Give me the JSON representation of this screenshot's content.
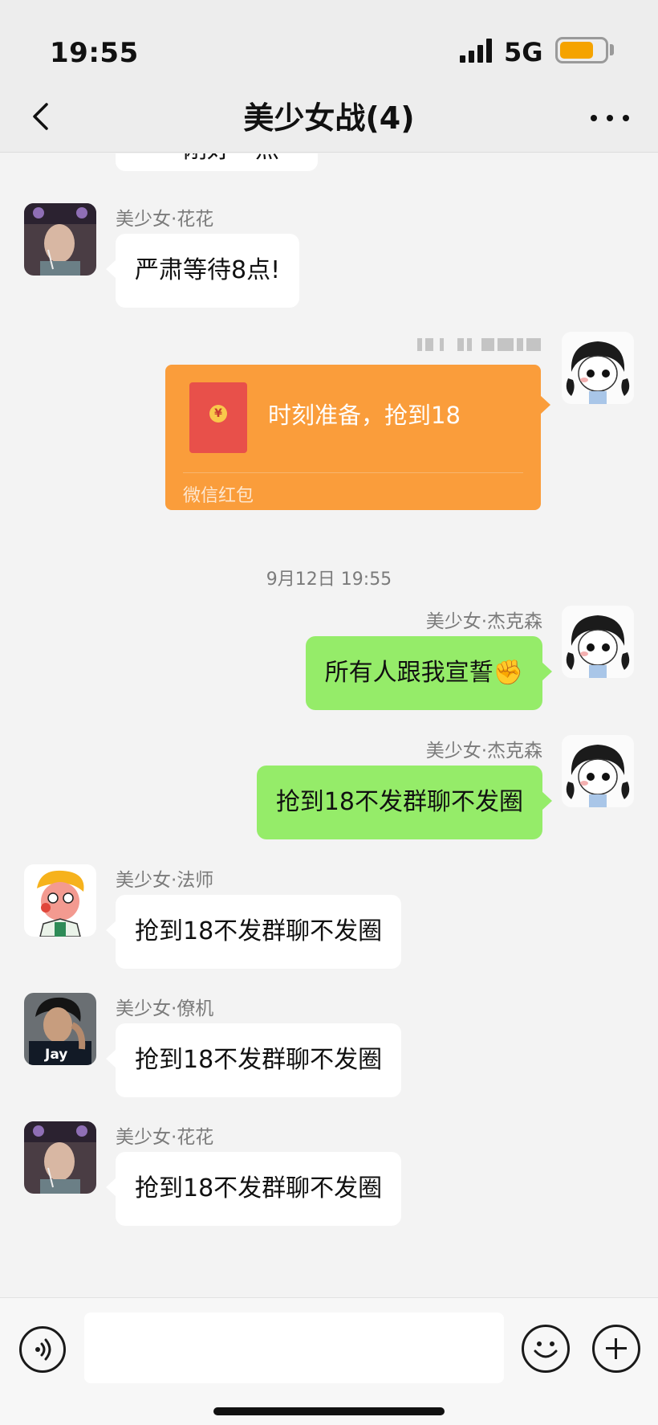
{
  "status_bar": {
    "time": "19:55",
    "network": "5G",
    "battery_level": 0.75
  },
  "nav": {
    "title": "美少女战(4)"
  },
  "chat": {
    "partial_top_text": "一一刚好一点",
    "messages": [
      {
        "sender": "美少女·花花",
        "text": "严肃等待8点!",
        "direction": "in",
        "avatar": "huahua-avatar"
      },
      {
        "type": "red_packet",
        "text": "时刻准备，抢到18",
        "label": "微信红包",
        "direction": "out"
      },
      {
        "type": "timestamp",
        "text": "9月12日 19:55"
      },
      {
        "sender": "美少女·杰克森",
        "text": "所有人跟我宣誓✊",
        "direction": "out",
        "avatar": "jackson-avatar"
      },
      {
        "sender": "美少女·杰克森",
        "text": "抢到18不发群聊不发圈",
        "direction": "out",
        "avatar": "jackson-avatar"
      },
      {
        "sender": "美少女·法师",
        "text": "抢到18不发群聊不发圈",
        "direction": "in",
        "avatar": "fashi-avatar"
      },
      {
        "sender": "美少女·僚机",
        "text": "抢到18不发群聊不发圈",
        "direction": "in",
        "avatar": "liaoji-avatar",
        "avatar_text": "Jay"
      },
      {
        "sender": "美少女·花花",
        "text": "抢到18不发群聊不发圈",
        "direction": "in",
        "avatar": "huahua-avatar"
      }
    ]
  },
  "input": {
    "value": "",
    "placeholder": ""
  },
  "colors": {
    "bubble_out": "#95ec69",
    "bubble_in": "#ffffff",
    "red_packet": "#fa9d3b",
    "background": "#f3f3f3"
  }
}
